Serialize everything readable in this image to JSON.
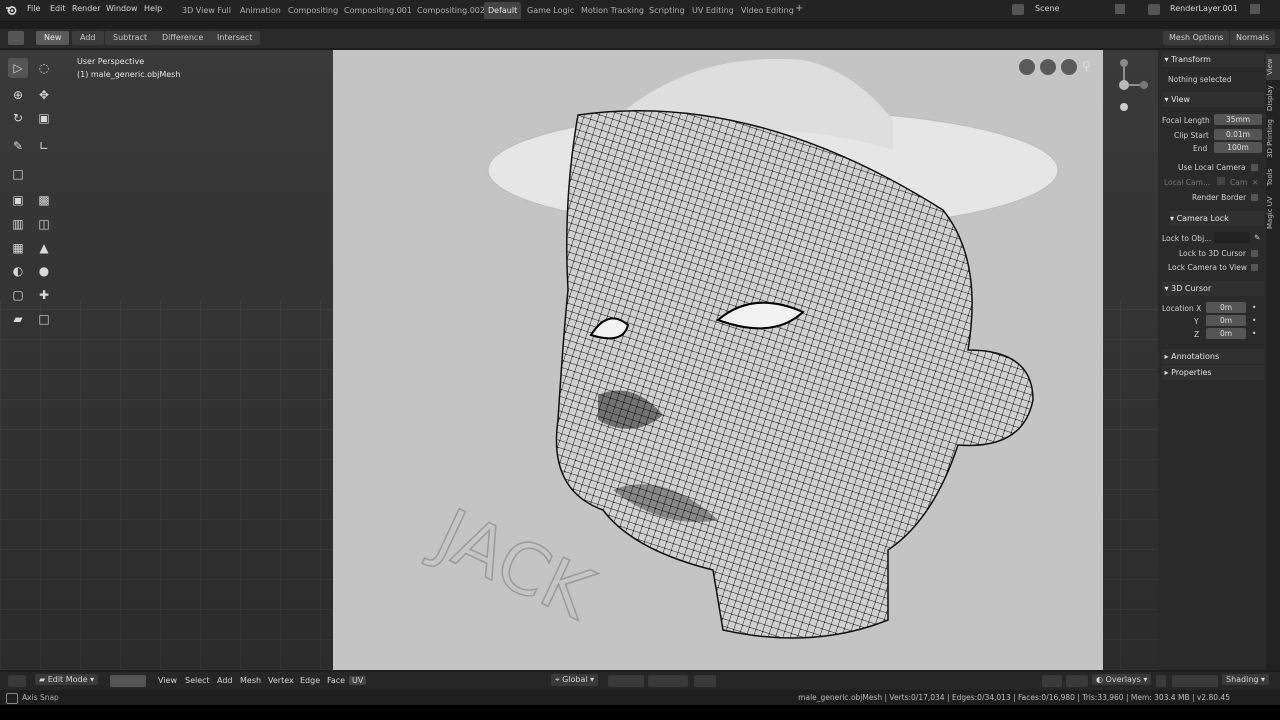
{
  "topbar": {
    "menus": [
      "File",
      "Edit",
      "Render",
      "Window",
      "Help"
    ],
    "workspace_tabs": [
      "3D View Full",
      "Animation",
      "Compositing",
      "Compositing.001",
      "Compositing.002",
      "Default",
      "Game Logic",
      "Motion Tracking",
      "Scripting",
      "UV Editing",
      "Video Editing"
    ],
    "active_tab": "Default",
    "scene_label": "Scene",
    "renderlayer_label": "RenderLayer.001"
  },
  "toolheader": {
    "modes": [
      "New",
      "Add",
      "Subtract",
      "Difference",
      "Intersect"
    ],
    "mesh_options": "Mesh Options",
    "normals": "Normals"
  },
  "viewport": {
    "view_name": "User Perspective",
    "object_name": "(1) male_generic.objMesh"
  },
  "npanel": {
    "tabs": [
      "View",
      "Display",
      "3D Printing",
      "Tools",
      "Magic UV"
    ],
    "transform_header": "Transform",
    "nothing_selected": "Nothing selected",
    "view_header": "View",
    "focal_length_label": "Focal Length",
    "focal_length_value": "35mm",
    "clip_start_label": "Clip Start",
    "clip_start_value": "0.01m",
    "end_label": "End",
    "end_value": "100m",
    "use_local_camera": "Use Local Camera",
    "local_camera_label": "Local Cam...",
    "local_camera_value": "Cam",
    "render_border": "Render Border",
    "camera_lock_header": "Camera Lock",
    "lock_to_obj": "Lock to Obj...",
    "lock_to_cursor": "Lock to 3D Cursor",
    "lock_camera_to_view": "Lock Camera to View",
    "cursor_header": "3D Cursor",
    "location_x_label": "Location X",
    "y_label": "Y",
    "z_label": "Z",
    "loc_x": "0m",
    "loc_y": "0m",
    "loc_z": "0m",
    "annotations_header": "Annotations",
    "properties_header": "Properties"
  },
  "bottombar": {
    "mode": "Edit Mode",
    "menus": [
      "View",
      "Select",
      "Add",
      "Mesh",
      "Vertex",
      "Edge",
      "Face",
      "UV"
    ],
    "orientation": "Global",
    "overlays": "Overlays",
    "shading": "Shading"
  },
  "status": {
    "left": "Axis Snap",
    "right": "male_generic.objMesh | Verts:0/17,034 | Edges:0/34,013 | Faces:0/16,980 | Tris:33,960 | Mem: 303.4 MB | v2.80.45"
  },
  "colors": {
    "topbar_bg": "#232323",
    "active_tab_bg": "#444444",
    "panel_bg": "#2a2a2a",
    "field_bg": "#555555",
    "reference_bg": "#c4c4c4"
  },
  "icons": [
    "blender-logo-icon",
    "select-box-icon",
    "cursor-icon",
    "move-icon",
    "rotate-icon",
    "scale-icon",
    "transform-icon",
    "annotate-icon",
    "measure-icon",
    "add-cube-icon",
    "extrude-icon",
    "inset-icon",
    "bevel-icon",
    "loopcut-icon",
    "knife-icon",
    "polybuild-icon",
    "spin-icon",
    "smooth-icon",
    "edge-slide-icon",
    "shrink-icon",
    "shear-icon",
    "rip-icon",
    "zoom-icon",
    "gizmo-icon",
    "scene-icon",
    "renderlayer-icon"
  ]
}
